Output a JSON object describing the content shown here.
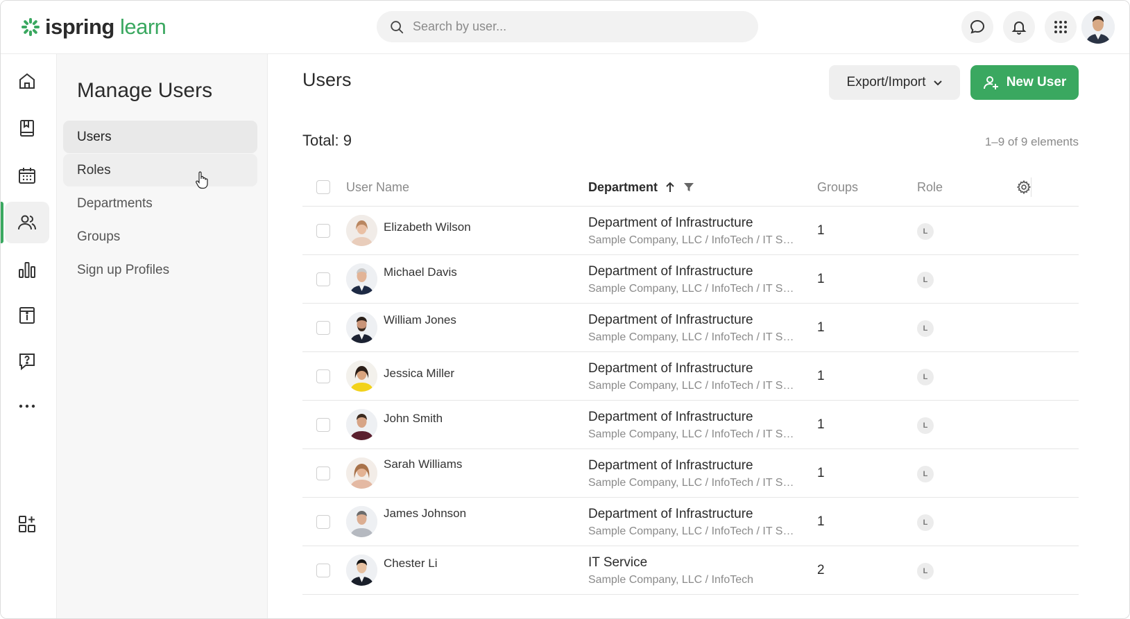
{
  "app": {
    "logo_part1": "ispring",
    "logo_part2": "learn",
    "brand_color": "#3aa860"
  },
  "search": {
    "placeholder": "Search by user..."
  },
  "topbar_icons": [
    "chat-bubble-icon",
    "bell-icon",
    "apps-grid-icon",
    "user-avatar"
  ],
  "rail_icons": [
    "home-icon",
    "book-icon",
    "calendar-icon",
    "users-icon",
    "bar-chart-icon",
    "info-board-icon",
    "help-chat-icon",
    "more-icon",
    "add-widget-icon"
  ],
  "sidebar": {
    "title": "Manage Users",
    "items": [
      {
        "label": "Users"
      },
      {
        "label": "Roles"
      },
      {
        "label": "Departments"
      },
      {
        "label": "Groups"
      },
      {
        "label": "Sign up Profiles"
      }
    ]
  },
  "main": {
    "title": "Users",
    "export_label": "Export/Import",
    "new_user_label": "New User",
    "total_label": "Total: 9",
    "range_label": "1–9 of 9 elements"
  },
  "table": {
    "columns": {
      "user_name": "User Name",
      "department": "Department",
      "groups": "Groups",
      "role": "Role"
    },
    "rows": [
      {
        "name": "Elizabeth Wilson",
        "dept": "Department of Infrastructure",
        "path": "Sample Company, LLC / InfoTech / IT Ser...",
        "groups": "1",
        "role": "L"
      },
      {
        "name": "Michael Davis",
        "dept": "Department of Infrastructure",
        "path": "Sample Company, LLC / InfoTech / IT Ser...",
        "groups": "1",
        "role": "L"
      },
      {
        "name": "William Jones",
        "dept": "Department of Infrastructure",
        "path": "Sample Company, LLC / InfoTech / IT Ser...",
        "groups": "1",
        "role": "L"
      },
      {
        "name": "Jessica Miller",
        "dept": "Department of Infrastructure",
        "path": "Sample Company, LLC / InfoTech / IT Ser...",
        "groups": "1",
        "role": "L"
      },
      {
        "name": "John Smith",
        "dept": "Department of Infrastructure",
        "path": "Sample Company, LLC / InfoTech / IT Ser...",
        "groups": "1",
        "role": "L"
      },
      {
        "name": "Sarah Williams",
        "dept": "Department of Infrastructure",
        "path": "Sample Company, LLC / InfoTech / IT Ser...",
        "groups": "1",
        "role": "L"
      },
      {
        "name": "James Johnson",
        "dept": "Department of Infrastructure",
        "path": "Sample Company, LLC / InfoTech / IT Ser...",
        "groups": "1",
        "role": "L"
      },
      {
        "name": "Chester Li",
        "dept": "IT Service",
        "path": "Sample Company, LLC / InfoTech",
        "groups": "2",
        "role": "L"
      }
    ]
  }
}
